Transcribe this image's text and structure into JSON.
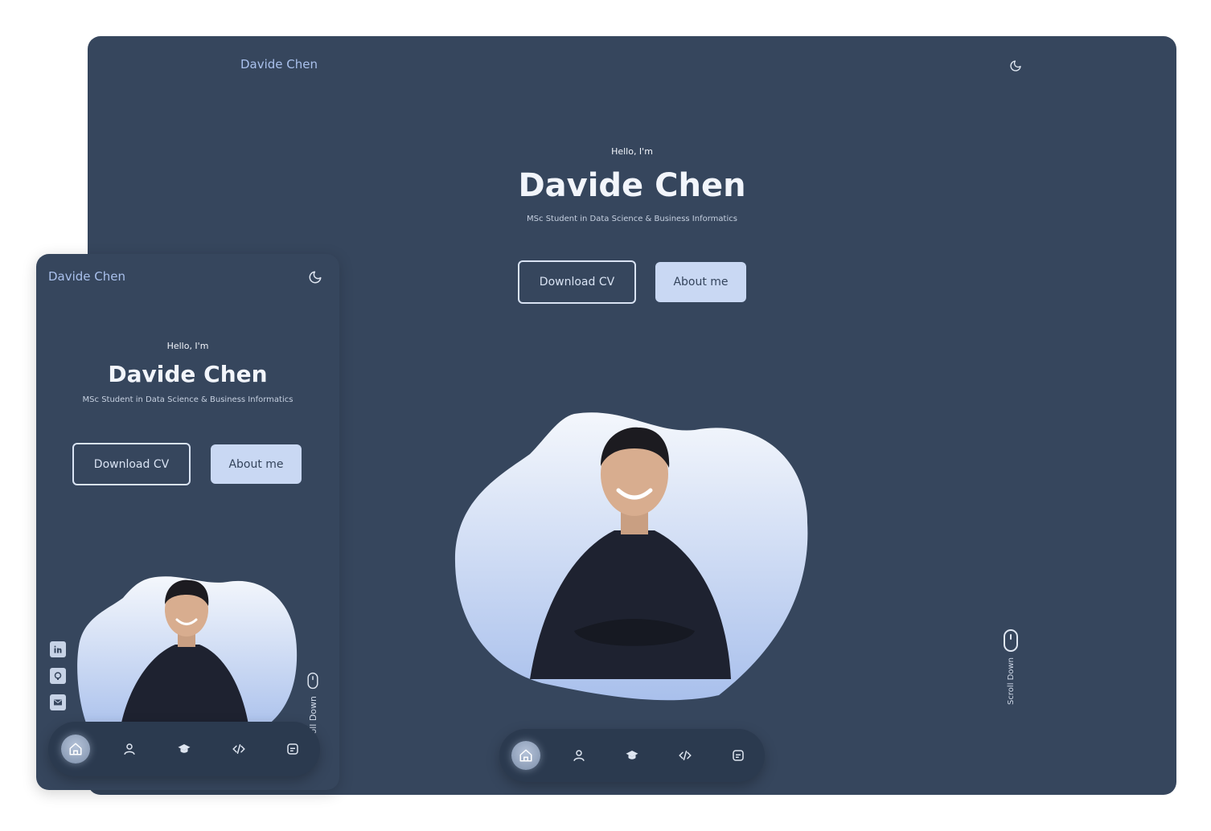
{
  "desktop": {
    "brand": "Davide Chen",
    "greeting": "Hello, I'm",
    "name": "Davide Chen",
    "role": "MSc Student in Data Science & Business Informatics",
    "download_cv": "Download CV",
    "about_me": "About me",
    "scroll_down": "Scroll Down",
    "nav": [
      "home-icon",
      "user-icon",
      "graduation-cap-icon",
      "code-icon",
      "message-icon"
    ],
    "active_nav": "home-icon"
  },
  "tablet": {
    "brand": "Davide Chen",
    "greeting": "Hello, I'm",
    "name": "Davide Chen",
    "role": "MSc Student in Data Science & Business Informatics",
    "download_cv": "Download CV",
    "about_me": "About me",
    "scroll_down": "Scroll Down",
    "socials": [
      "linkedin-icon",
      "github-icon",
      "mail-icon"
    ],
    "nav": [
      "home-icon",
      "user-icon",
      "graduation-cap-icon",
      "code-icon",
      "message-icon"
    ],
    "active_nav": "home-icon"
  },
  "colors": {
    "background": "#36465d",
    "accent": "#a9c0ec",
    "button_fill": "#c9d8f3",
    "dock": "#2b3a4f"
  }
}
